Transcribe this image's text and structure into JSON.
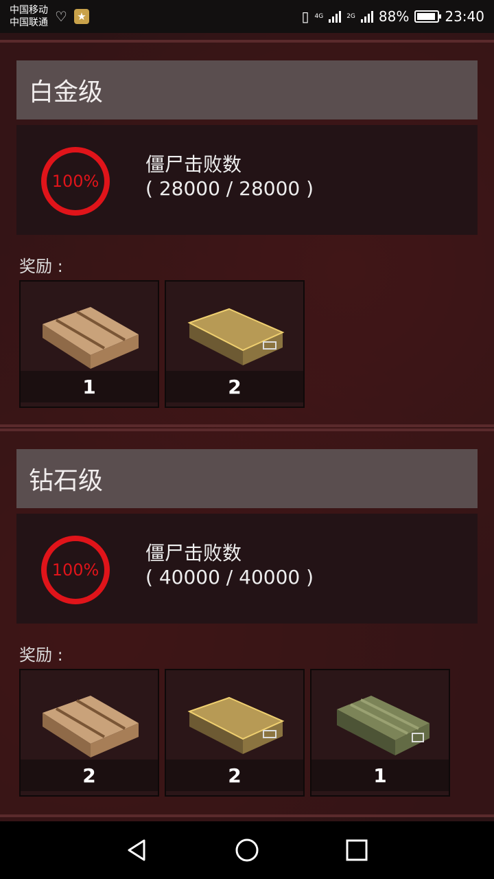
{
  "status_bar": {
    "carrier_1": "中国移动",
    "carrier_2": "中国联通",
    "network_1": "4G",
    "network_2": "2G",
    "battery": "88%",
    "time": "23:40"
  },
  "tiers": [
    {
      "title": "白金级",
      "progress_label": "僵尸击败数",
      "progress_percent": "100%",
      "progress_count": "( 28000 / 28000 )",
      "rewards_label": "奖励 :",
      "rewards": [
        {
          "icon": "wooden-crate-icon",
          "quantity": "1"
        },
        {
          "icon": "gold-crate-icon",
          "quantity": "2"
        }
      ]
    },
    {
      "title": "钻石级",
      "progress_label": "僵尸击败数",
      "progress_percent": "100%",
      "progress_count": "( 40000 / 40000 )",
      "rewards_label": "奖励 :",
      "rewards": [
        {
          "icon": "wooden-crate-icon",
          "quantity": "2"
        },
        {
          "icon": "gold-crate-icon",
          "quantity": "2"
        },
        {
          "icon": "military-crate-icon",
          "quantity": "1"
        }
      ]
    }
  ],
  "colors": {
    "background": "#2b1315",
    "header": "#5a4e4f",
    "progress_ring": "#e0141a"
  }
}
